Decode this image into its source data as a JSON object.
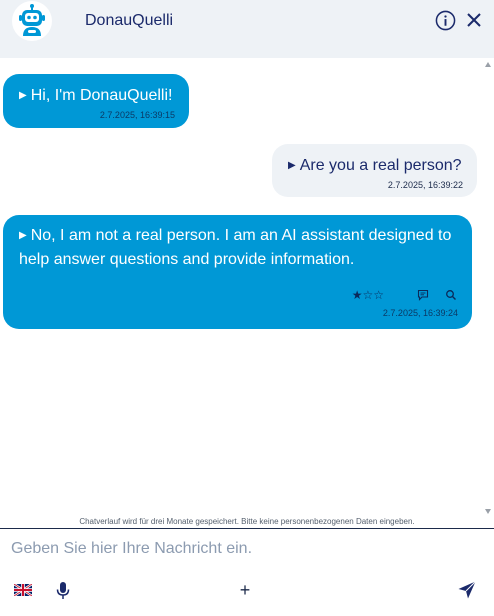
{
  "header": {
    "title": "DonauQuelli",
    "avatar_icon": "robot-icon",
    "info_icon": "info-icon",
    "close_icon": "close-icon"
  },
  "messages": [
    {
      "role": "bot",
      "text": "Hi, I'm DonauQuelli!",
      "timestamp": "2.7.2025, 16:39:15"
    },
    {
      "role": "user",
      "text": "Are you a real person?",
      "timestamp": "2.7.2025, 16:39:22"
    },
    {
      "role": "bot",
      "text_line1": "No, I am not a real person. I am an AI assistant designed to",
      "text_line2": "help answer questions and provide information.",
      "timestamp": "2.7.2025, 16:39:24",
      "rating": 1,
      "rating_max": 5
    }
  ],
  "notice": "Chatverlauf wird für drei Monate gespeichert. Bitte keine personenbezogenen Daten eingeben.",
  "composer": {
    "placeholder": "Geben Sie hier Ihre Nachricht ein.",
    "value": "",
    "language_icon": "uk-flag-icon",
    "mic_icon": "microphone-icon",
    "plus_label": "+",
    "send_icon": "send-icon"
  },
  "colors": {
    "bot_bubble": "#0098d6",
    "user_bubble": "#eef2f6",
    "header_bg": "#eef2f6",
    "accent": "#1b2a6b"
  }
}
